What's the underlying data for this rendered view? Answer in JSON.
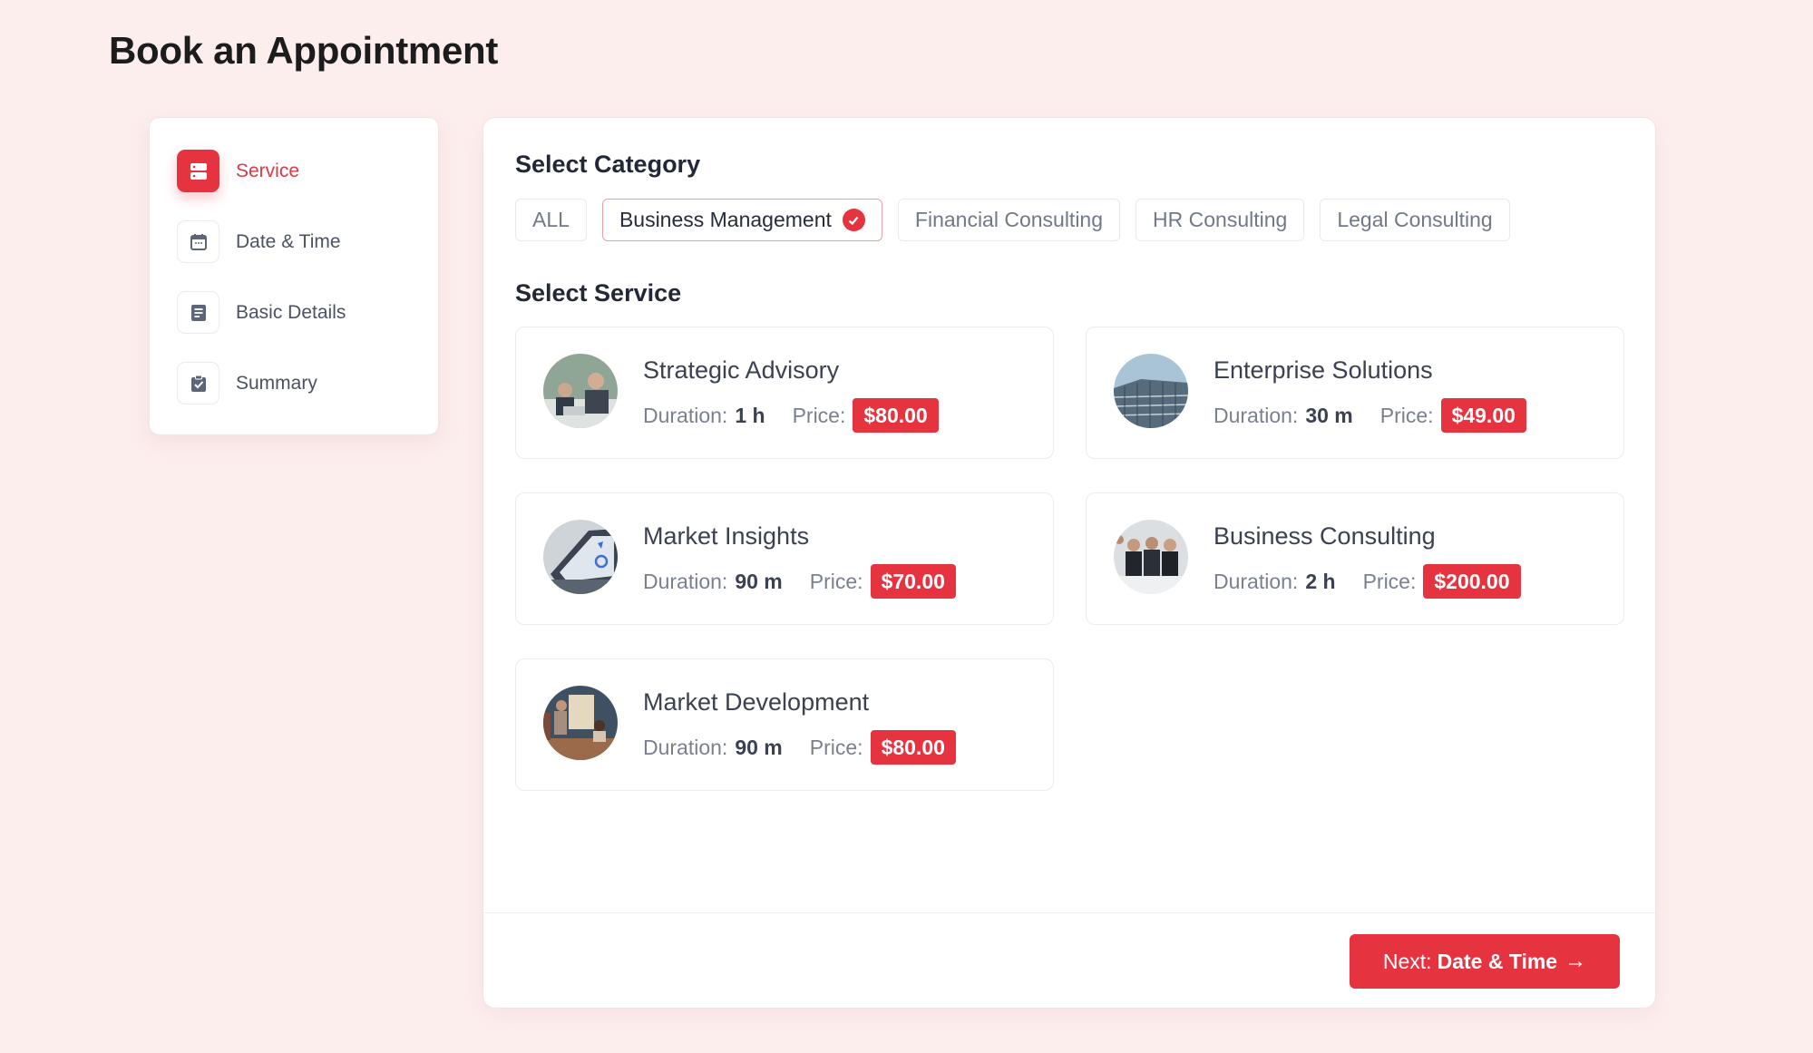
{
  "page": {
    "title": "Book an Appointment"
  },
  "colors": {
    "accent": "#e5343f",
    "background": "#fdeeee"
  },
  "steps": [
    {
      "label": "Service",
      "icon": "service-icon",
      "active": true
    },
    {
      "label": "Date & Time",
      "icon": "calendar-icon",
      "active": false
    },
    {
      "label": "Basic Details",
      "icon": "document-icon",
      "active": false
    },
    {
      "label": "Summary",
      "icon": "clipboard-check-icon",
      "active": false
    }
  ],
  "category": {
    "title": "Select Category",
    "chips": [
      {
        "label": "ALL",
        "selected": false
      },
      {
        "label": "Business Management",
        "selected": true
      },
      {
        "label": "Financial Consulting",
        "selected": false
      },
      {
        "label": "HR Consulting",
        "selected": false
      },
      {
        "label": "Legal Consulting",
        "selected": false
      }
    ]
  },
  "service": {
    "title": "Select Service",
    "duration_label": "Duration:",
    "price_label": "Price:",
    "items": [
      {
        "name": "Strategic Advisory",
        "duration": "1 h",
        "price": "$80.00",
        "image": "meeting-photo"
      },
      {
        "name": "Enterprise Solutions",
        "duration": "30 m",
        "price": "$49.00",
        "image": "building-photo"
      },
      {
        "name": "Market Insights",
        "duration": "90 m",
        "price": "$70.00",
        "image": "laptop-analytics-photo"
      },
      {
        "name": "Business Consulting",
        "duration": "2 h",
        "price": "$200.00",
        "image": "team-photo"
      },
      {
        "name": "Market Development",
        "duration": "90 m",
        "price": "$80.00",
        "image": "presentation-photo"
      }
    ]
  },
  "footer": {
    "next_prefix": "Next:",
    "next_target": "Date & Time",
    "next_arrow": "→"
  }
}
